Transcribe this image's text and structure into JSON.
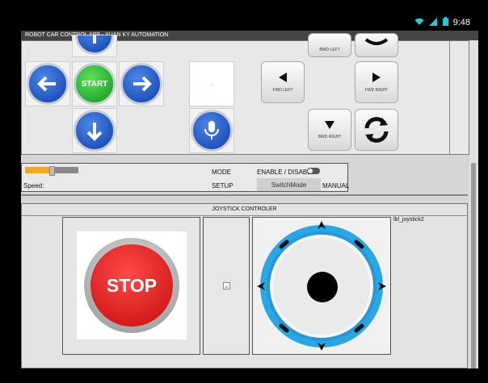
{
  "status_bar": {
    "time": "9:48"
  },
  "app": {
    "title": "ROBOT CAR CONTROL APP - XUAN KY AUTOMATION"
  },
  "dpad": {
    "start_label": "START"
  },
  "keys": {
    "bwd_left_top": "BWD LEFT",
    "fwd_left": "FWD LEFT",
    "fwd_right": "FWD RIGHT",
    "bwd_right": "BWD RIGHT"
  },
  "settings": {
    "mode_label": "MODE",
    "enable_label": "ENABLE / DISABLE",
    "speed_label": "Speed:",
    "setup_label": "SETUP",
    "switch_button": "SwitchMode",
    "manual_label": "MANUAL",
    "speed_level": 0.5,
    "enable_state": "off"
  },
  "joystick": {
    "header": "JOYSTICK CONTROLER",
    "stop_label": "STOP",
    "side_label": "lbl_joystick2"
  },
  "colors": {
    "accent_orange": "#f5a623",
    "blue_button": "#1a56d6",
    "green_button": "#16a61e",
    "stop_red": "#e01515",
    "joystick_blue": "#29a6e0"
  }
}
